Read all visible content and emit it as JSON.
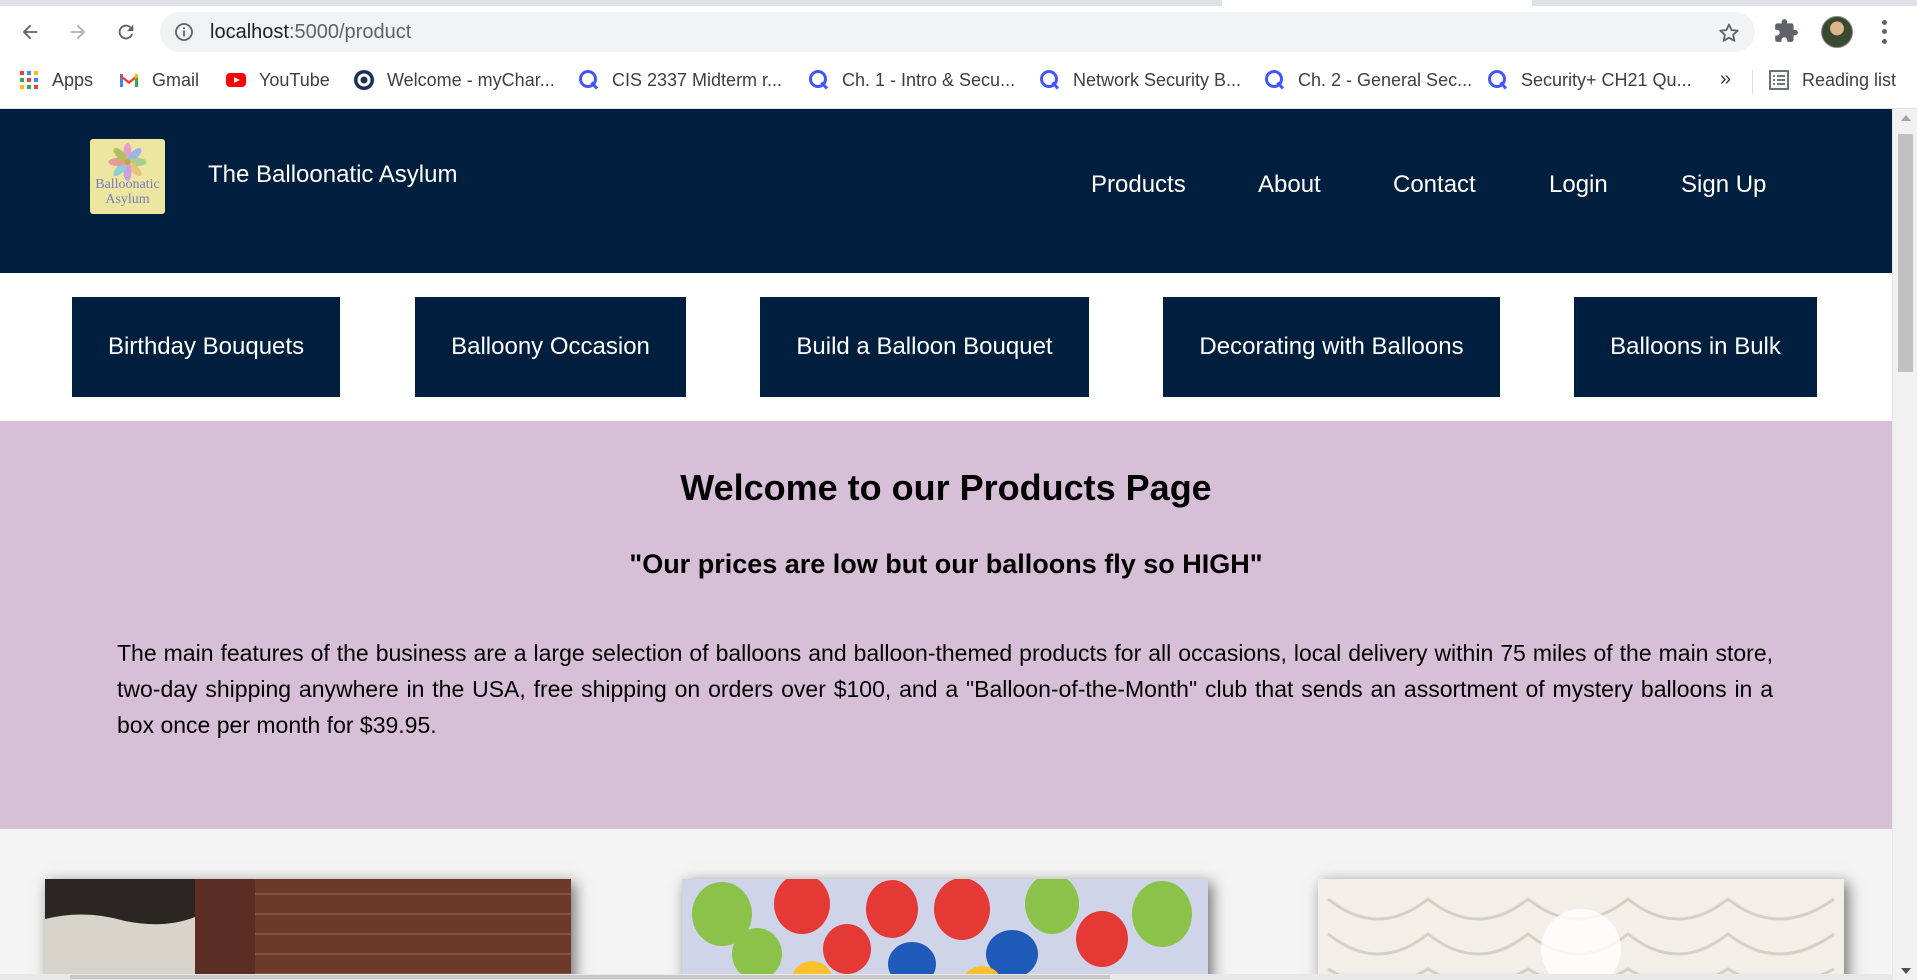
{
  "browser": {
    "url_host": "localhost",
    "url_path": ":5000/product",
    "bookmarks": [
      {
        "label": "Apps",
        "icon": "apps-grid-icon"
      },
      {
        "label": "Gmail",
        "icon": "gmail-icon"
      },
      {
        "label": "YouTube",
        "icon": "youtube-icon"
      },
      {
        "label": "Welcome - myChar...",
        "icon": "college-seal-icon"
      },
      {
        "label": "CIS 2337 Midterm r...",
        "icon": "quizlet-icon"
      },
      {
        "label": "Ch. 1 - Intro & Secu...",
        "icon": "quizlet-icon"
      },
      {
        "label": "Network Security B...",
        "icon": "quizlet-icon"
      },
      {
        "label": "Ch. 2 - General Sec...",
        "icon": "quizlet-icon"
      },
      {
        "label": "Security+ CH21 Qu...",
        "icon": "quizlet-icon"
      }
    ],
    "more_bookmarks": "»",
    "reading_list": "Reading list"
  },
  "site": {
    "logo_line1": "Balloonatic",
    "logo_line2": "Asylum",
    "name": "The Balloonatic Asylum",
    "nav": [
      "Products",
      "About",
      "Contact",
      "Login",
      "Sign Up"
    ]
  },
  "categories": [
    "Birthday Bouquets",
    "Balloony Occasion",
    "Build a Balloon Bouquet",
    "Decorating with Balloons",
    "Balloons in Bulk"
  ],
  "hero": {
    "title": "Welcome to our Products Page",
    "tagline": "\"Our prices are low but our balloons fly so HIGH\"",
    "description": "The main features of the business are a large selection of balloons and balloon-themed products for all occasions, local delivery within 75 miles of the main store, two-day shipping anywhere in the USA, free shipping on orders over $100, and a \"Balloon-of-the-Month\" club that sends an assortment of mystery balloons in a box once per month for $39.95."
  },
  "colors": {
    "header_bg": "#001e3d",
    "hero_bg": "#d8bfd8",
    "logo_bg": "#ede6a0"
  }
}
